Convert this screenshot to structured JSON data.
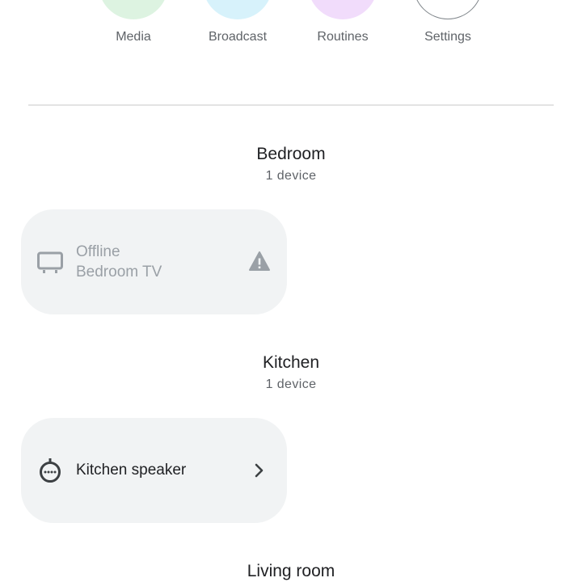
{
  "quick_actions": [
    {
      "label": "Media",
      "color": "#ddf3e1"
    },
    {
      "label": "Broadcast",
      "color": "#d7f2fb"
    },
    {
      "label": "Routines",
      "color": "#f1dcfb"
    },
    {
      "label": "Settings",
      "color": "#ffffff"
    }
  ],
  "rooms": [
    {
      "name": "Bedroom",
      "count": "1 device",
      "devices": [
        {
          "status": "Offline",
          "name": "Bedroom TV",
          "icon": "tv-icon",
          "trail_icon": "warning-icon"
        }
      ]
    },
    {
      "name": "Kitchen",
      "count": "1 device",
      "devices": [
        {
          "name": "Kitchen speaker",
          "icon": "speaker-icon",
          "trail_icon": "chevron-right-icon"
        }
      ]
    },
    {
      "name": "Living room"
    }
  ],
  "colors": {
    "card_bg": "#f1f3f4",
    "offline_text": "#9aa0a6",
    "icon_grey": "#5f6368"
  }
}
